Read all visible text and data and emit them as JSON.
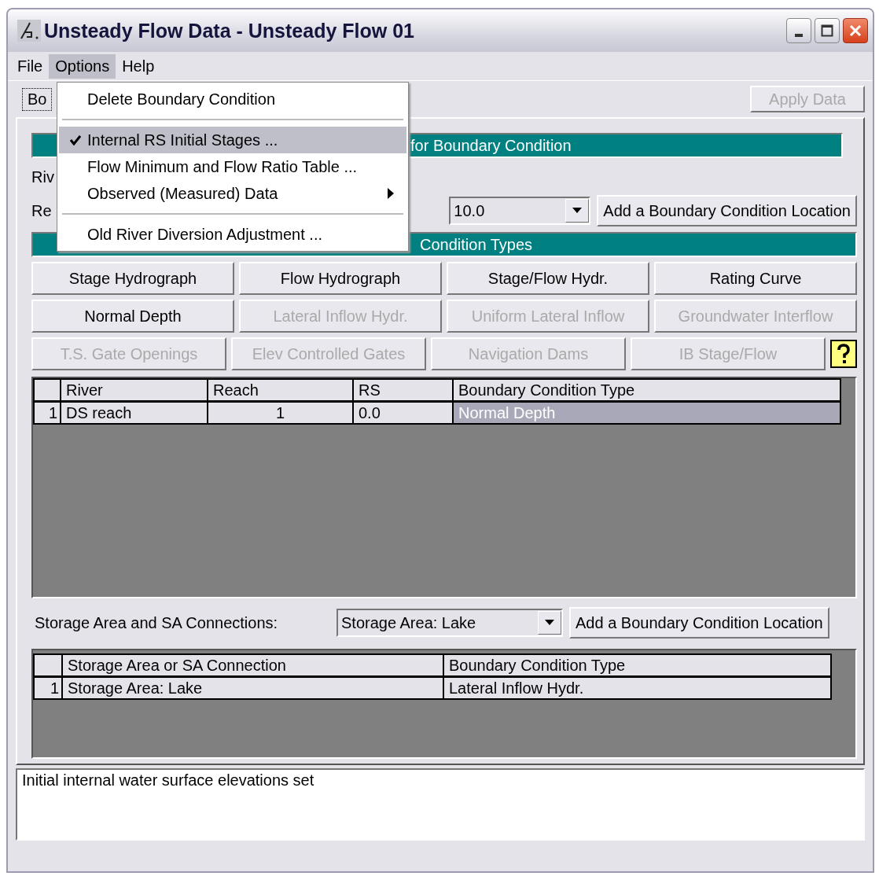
{
  "window": {
    "title": "Unsteady Flow Data - Unsteady Flow 01"
  },
  "menu": [
    {
      "label": "File",
      "selected": false
    },
    {
      "label": "Options",
      "selected": true
    },
    {
      "label": "Help",
      "selected": false
    }
  ],
  "dropdown": [
    {
      "kind": "item",
      "label": "Delete Boundary Condition",
      "checked": false,
      "highlighted": false,
      "submenu": false
    },
    {
      "kind": "separator"
    },
    {
      "kind": "item",
      "label": "Internal RS Initial Stages ...",
      "checked": true,
      "highlighted": true,
      "submenu": false
    },
    {
      "kind": "item",
      "label": "Flow Minimum and Flow Ratio Table ...",
      "checked": false,
      "highlighted": false,
      "submenu": false
    },
    {
      "kind": "item",
      "label": "Observed (Measured) Data",
      "checked": false,
      "highlighted": false,
      "submenu": true
    },
    {
      "kind": "separator"
    },
    {
      "kind": "item",
      "label": "Old River Diversion Adjustment ...",
      "checked": false,
      "highlighted": false,
      "submenu": false
    }
  ],
  "tab": {
    "label": "Bo"
  },
  "apply_button": {
    "label": "Apply Data",
    "disabled": true
  },
  "location_header": "for Boundary Condition",
  "river_label": "Riv",
  "reach_label": "Re",
  "rs_select": {
    "value": "10.0"
  },
  "add_location_button": "Add a Boundary Condition Location",
  "types_header": "Condition Types",
  "bc_buttons": [
    [
      {
        "label": "Stage Hydrograph",
        "disabled": false
      },
      {
        "label": "Flow Hydrograph",
        "disabled": false
      },
      {
        "label": "Stage/Flow Hydr.",
        "disabled": false
      },
      {
        "label": "Rating Curve",
        "disabled": false
      }
    ],
    [
      {
        "label": "Normal Depth",
        "disabled": false
      },
      {
        "label": "Lateral Inflow Hydr.",
        "disabled": true
      },
      {
        "label": "Uniform Lateral Inflow",
        "disabled": true
      },
      {
        "label": "Groundwater Interflow",
        "disabled": true
      }
    ],
    [
      {
        "label": "T.S. Gate Openings",
        "disabled": true
      },
      {
        "label": "Elev Controlled Gates",
        "disabled": true
      },
      {
        "label": "Navigation Dams",
        "disabled": true
      },
      {
        "label": "IB Stage/Flow",
        "disabled": true
      }
    ]
  ],
  "bc_table": {
    "columns": [
      "River",
      "Reach",
      "RS",
      "Boundary Condition Type"
    ],
    "rows": [
      {
        "number": "1",
        "river": "DS reach",
        "reach": "1",
        "rs": "0.0",
        "type": "Normal Depth",
        "selected": true
      }
    ]
  },
  "storage_label": "Storage Area and SA Connections:",
  "storage_select": {
    "value": "Storage Area: Lake"
  },
  "storage_add_button": "Add a Boundary Condition Location",
  "sa_table": {
    "columns": [
      "Storage Area or SA Connection",
      "Boundary Condition Type"
    ],
    "rows": [
      {
        "number": "1",
        "area": "Storage Area: Lake",
        "type": "Lateral Inflow Hydr.",
        "selected": false
      }
    ]
  },
  "status_message": "Initial internal water surface elevations set"
}
